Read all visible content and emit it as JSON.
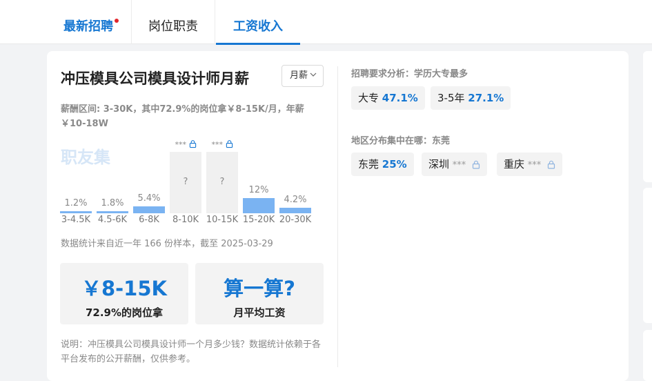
{
  "tabs": [
    {
      "label": "最新招聘",
      "active": false,
      "has_dot": true
    },
    {
      "label": "岗位职责",
      "active": false
    },
    {
      "label": "工资收入",
      "active": true
    }
  ],
  "main": {
    "title": "冲压模具公司模具设计师月薪",
    "period_select": "月薪",
    "range_text": "薪酬区间: 3-30K，其中72.9%的岗位拿￥8-15K/月，年薪￥10-18W",
    "watermark": "职友集",
    "stats_note": "数据统计来自近一年 166 份样本，截至 2025-03-29",
    "box_salary": {
      "value": "￥8-15K",
      "caption": "72.9%的岗位拿"
    },
    "box_calc": {
      "value": "算一算?",
      "caption": "月平均工资"
    },
    "description": "说明：冲压模具公司模具设计师一个月多少钱？数据统计依赖于各平台发布的公开薪酬，仅供参考。"
  },
  "chart_data": {
    "type": "bar",
    "categories": [
      "3-4.5K",
      "4.5-6K",
      "6-8K",
      "8-10K",
      "10-15K",
      "15-20K",
      "20-30K"
    ],
    "values": [
      1.2,
      1.8,
      5.4,
      null,
      null,
      12,
      4.2
    ],
    "value_labels": [
      "1.2%",
      "1.8%",
      "5.4%",
      "?",
      "?",
      "12%",
      "4.2%"
    ],
    "locked": [
      false,
      false,
      false,
      true,
      true,
      false,
      false
    ],
    "locked_label": "***",
    "unit": "%"
  },
  "side": {
    "requirements_label": "招聘要求分析：学历大专最多",
    "requirements": [
      {
        "name": "大专",
        "value": "47.1%"
      },
      {
        "name": "3-5年",
        "value": "27.1%"
      }
    ],
    "regions_label": "地区分布集中在哪：东莞",
    "regions": [
      {
        "name": "东莞",
        "value": "25%",
        "locked": false
      },
      {
        "name": "深圳",
        "value": "***",
        "locked": true
      },
      {
        "name": "重庆",
        "value": "***",
        "locked": true
      }
    ]
  },
  "colors": {
    "accent": "#1677d2",
    "bar": "#7ab3f2",
    "locked_bar": "#f0f0f0",
    "dot": "#e2262c"
  },
  "icons": {
    "lock": "lock-icon",
    "chevron": "chevron-down-icon"
  }
}
